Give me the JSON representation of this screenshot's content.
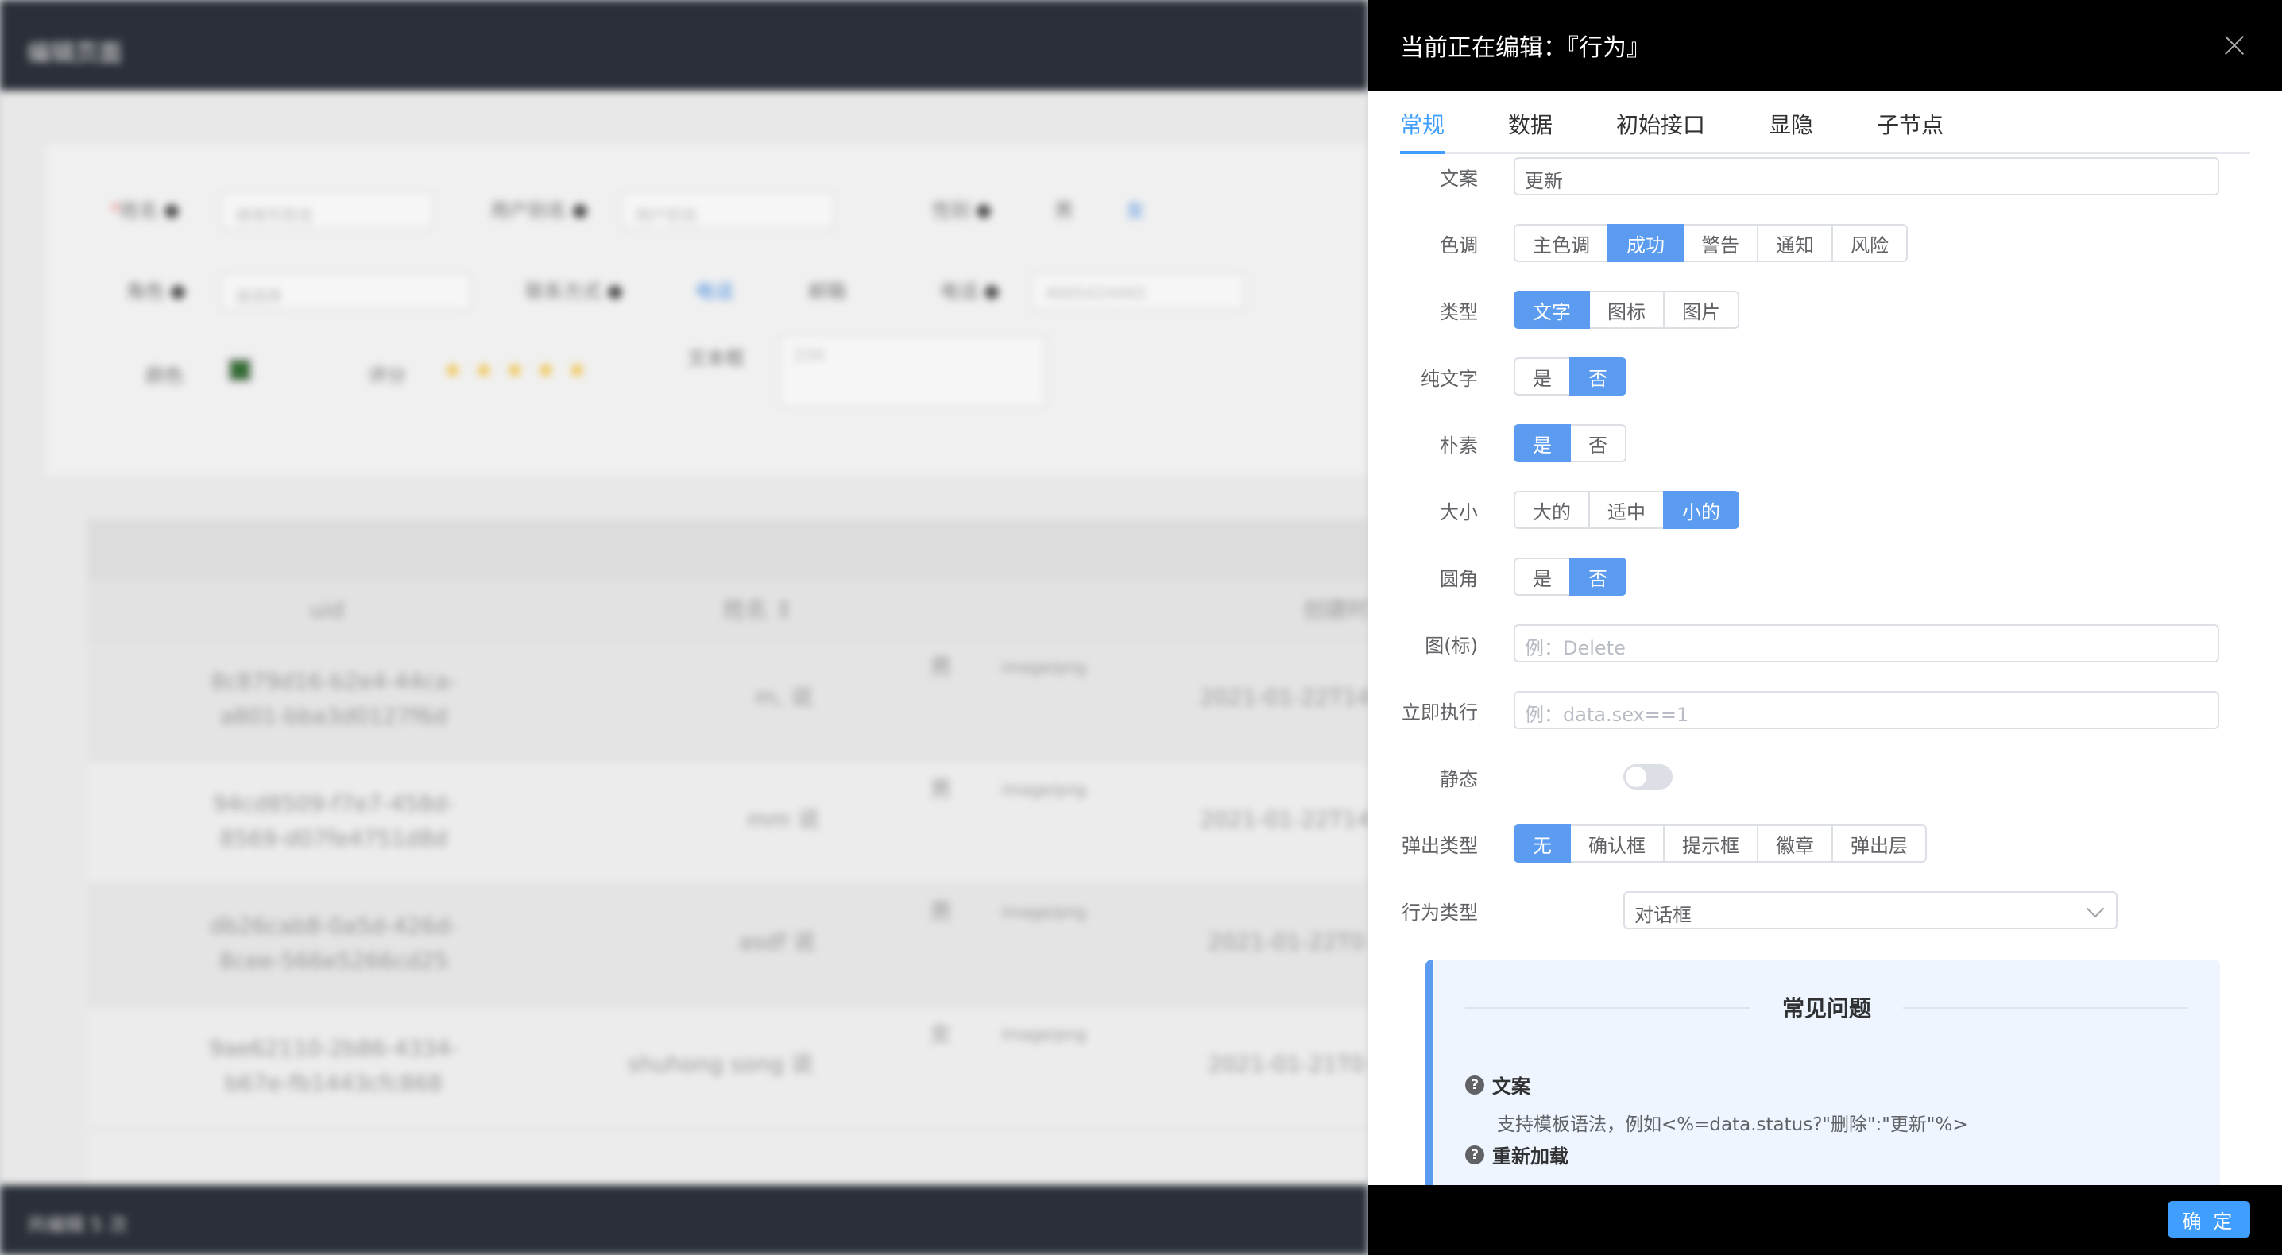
{
  "background": {
    "header_title": "编辑页面",
    "footer_text": "共编辑 5 次",
    "form": {
      "name_label": "姓名",
      "name_placeholder": "请填写姓名",
      "nickname_label": "用户别名",
      "nickname_placeholder": "用户别名",
      "gender_label": "性别",
      "gender_male": "男",
      "gender_female": "女",
      "role_label": "角色",
      "role_value": "请选择",
      "contact_label": "联系方式",
      "contact_phone": "电话",
      "contact_email": "邮箱",
      "phone_label": "电话",
      "phone_value": "4665424465",
      "color_label": "颜色",
      "rating_label": "评分",
      "textarea_label": "文本框",
      "textarea_value": "234"
    },
    "table": {
      "columns": [
        "uid",
        "姓名 ↕",
        "",
        "创建时间"
      ],
      "rows": [
        {
          "uid": "8c879d16-b2e4-44ca-a801-bba3d0127f6d",
          "name": "m, 说",
          "tag": "男",
          "img": "image/png",
          "time": "2021-01-22T14"
        },
        {
          "uid": "94cd8509-f7e7-458d-8569-d07fe4751d8d",
          "name": "mm 说",
          "tag": "男",
          "img": "image/png",
          "time": "2021-01-22T14"
        },
        {
          "uid": "db26cab8-0a5d-426d-8cee-566e5266cd25",
          "name": "asdf 说",
          "tag": "男",
          "img": "image/png",
          "time": "2021-01-22T0"
        },
        {
          "uid": "9ae62110-2b86-4334-b67e-fb1443cfc868",
          "name": "shuhong song 说",
          "tag": "女",
          "img": "image/png",
          "time": "2021-01-21T0"
        }
      ]
    }
  },
  "drawer": {
    "title": "当前正在编辑：『行为』",
    "tabs": [
      "常规",
      "数据",
      "初始接口",
      "显隐",
      "子节点"
    ],
    "fields": {
      "copy": {
        "label": "文案",
        "value": "更新"
      },
      "tone": {
        "label": "色调",
        "options": [
          "主色调",
          "成功",
          "警告",
          "通知",
          "风险"
        ],
        "selected": "成功"
      },
      "type": {
        "label": "类型",
        "options": [
          "文字",
          "图标",
          "图片"
        ],
        "selected": "文字"
      },
      "plain_text": {
        "label": "纯文字",
        "options": [
          "是",
          "否"
        ],
        "selected": "否"
      },
      "plain": {
        "label": "朴素",
        "options": [
          "是",
          "否"
        ],
        "selected": "是"
      },
      "size": {
        "label": "大小",
        "options": [
          "大的",
          "适中",
          "小的"
        ],
        "selected": "小的"
      },
      "round": {
        "label": "圆角",
        "options": [
          "是",
          "否"
        ],
        "selected": "否"
      },
      "icon": {
        "label": "图(标)",
        "placeholder": "例：Delete"
      },
      "immediate": {
        "label": "立即执行",
        "placeholder": "例：data.sex==1"
      },
      "static": {
        "label": "静态",
        "value": false
      },
      "popup_type": {
        "label": "弹出类型",
        "options": [
          "无",
          "确认框",
          "提示框",
          "徽章",
          "弹出层"
        ],
        "selected": "无"
      },
      "action_type": {
        "label": "行为类型",
        "value": "对话框"
      }
    },
    "faq": {
      "title": "常见问题",
      "items": [
        {
          "q": "文案",
          "a": "支持模板语法，例如<%=data.status?\"删除\":\"更新\"%>"
        },
        {
          "q": "重新加载",
          "a": ""
        }
      ]
    },
    "confirm_label": "确 定"
  },
  "colors": {
    "accent": "#409eff",
    "segment_active": "#5b9cf0",
    "header_bg": "#000000",
    "faq_bg": "#eef5fe"
  }
}
